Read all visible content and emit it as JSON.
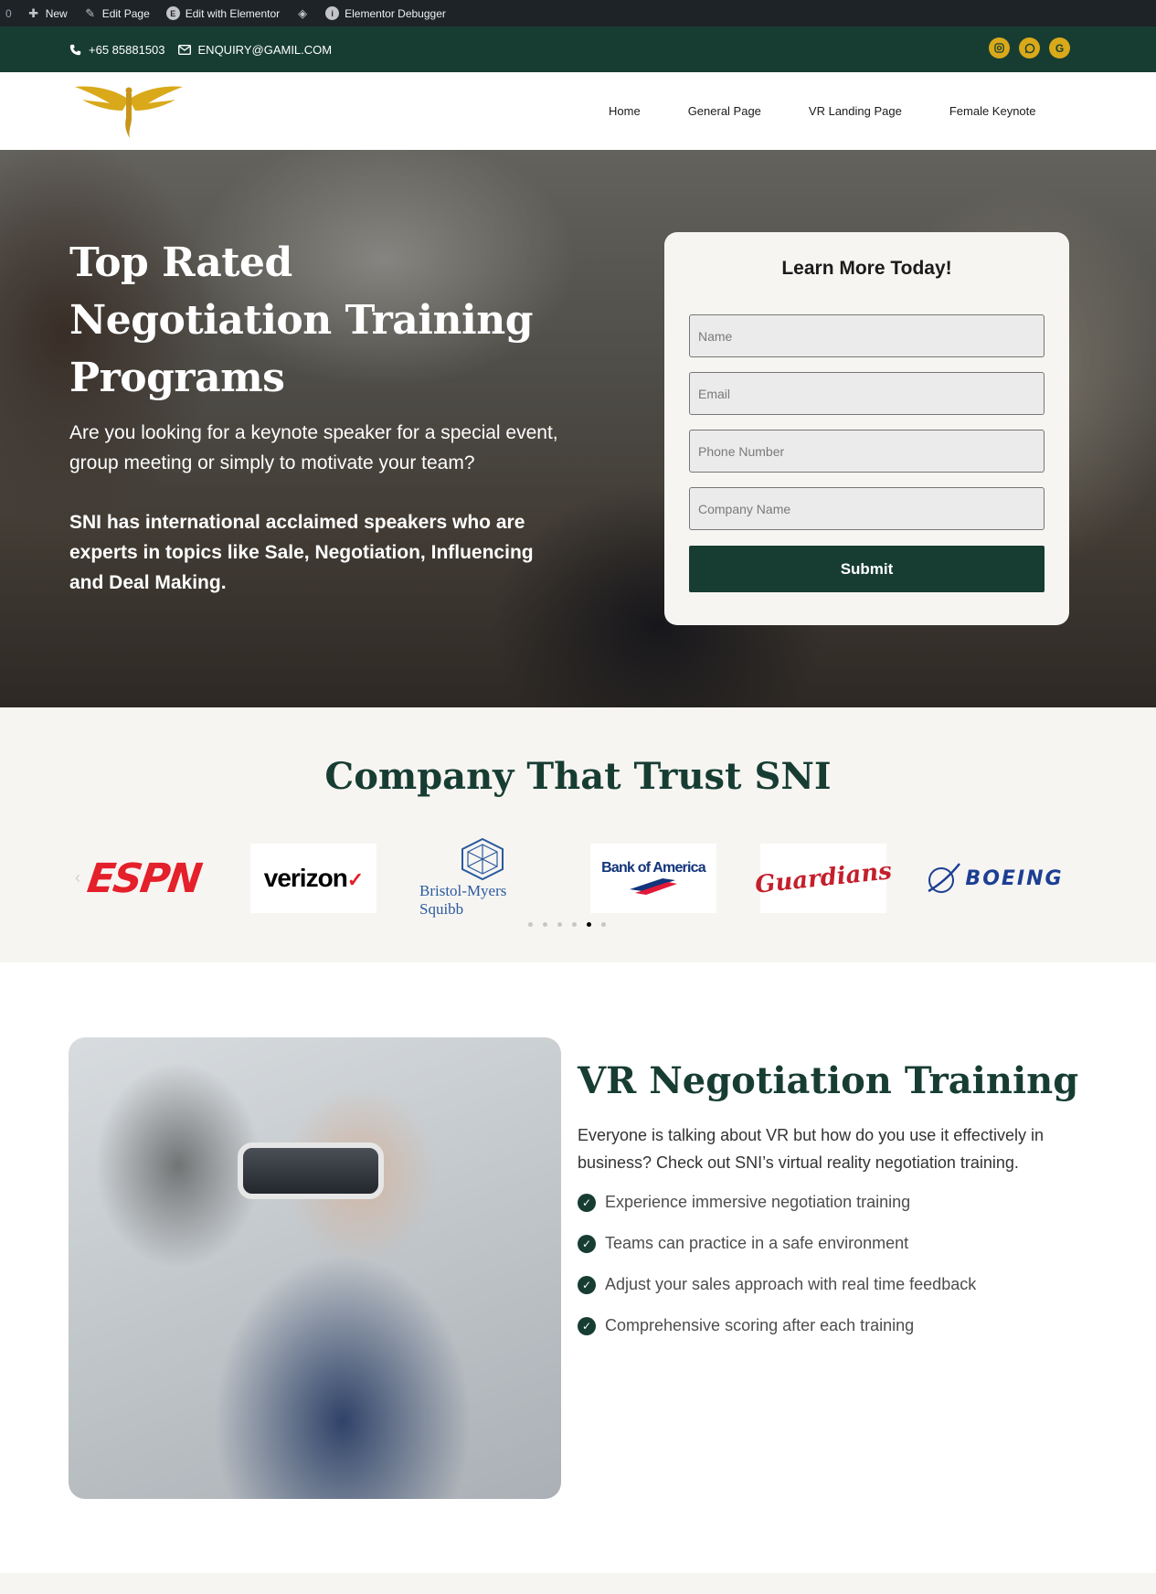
{
  "adminbar": {
    "count": "0",
    "new_label": "New",
    "edit_page_label": "Edit Page",
    "elementor_label": "Edit with Elementor",
    "debugger_label": "Elementor Debugger"
  },
  "topbar": {
    "phone": "+65 85881503",
    "email": "ENQUIRY@GAMIL.COM",
    "socials": [
      "instagram-icon",
      "whatsapp-icon",
      "google-icon"
    ],
    "color": "#173d33",
    "social_color": "#d9a91a"
  },
  "nav": {
    "items": [
      "Home",
      "General Page",
      "VR Landing Page",
      "Female Keynote"
    ]
  },
  "hero": {
    "title": "Top Rated Negotiation Training Programs",
    "paragraph1": "Are you looking for a keynote speaker for a special event, group meeting or simply to motivate your team?",
    "paragraph2": "SNI has international acclaimed speakers who are experts in topics like Sale, Negotiation, Influencing and Deal Making."
  },
  "form": {
    "title": "Learn More Today!",
    "name_placeholder": "Name",
    "email_placeholder": "Email",
    "phone_placeholder": "Phone Number",
    "company_placeholder": "Company Name",
    "submit_label": "Submit"
  },
  "trust": {
    "title": "Company That Trust SNI",
    "logos": {
      "espn": "ESPN",
      "verizon": "verizon",
      "bms": "Bristol-Myers Squibb",
      "boa": "Bank of America",
      "guardians": "Guardians",
      "boeing": "BOEING"
    },
    "active_dot": 5,
    "dot_count": 6
  },
  "vr": {
    "title": "VR Negotiation Training",
    "description": "Everyone is talking about VR but how do you use it effectively in business? Check out SNI’s virtual reality negotiation training.",
    "features": [
      "Experience immersive negotiation training",
      "Teams can practice in a safe environment",
      "Adjust your sales approach with real time feedback",
      "Comprehensive scoring after each training"
    ]
  },
  "colors": {
    "brand_green": "#173d33",
    "gold": "#d9a91a",
    "cream": "#f7f5f2"
  }
}
